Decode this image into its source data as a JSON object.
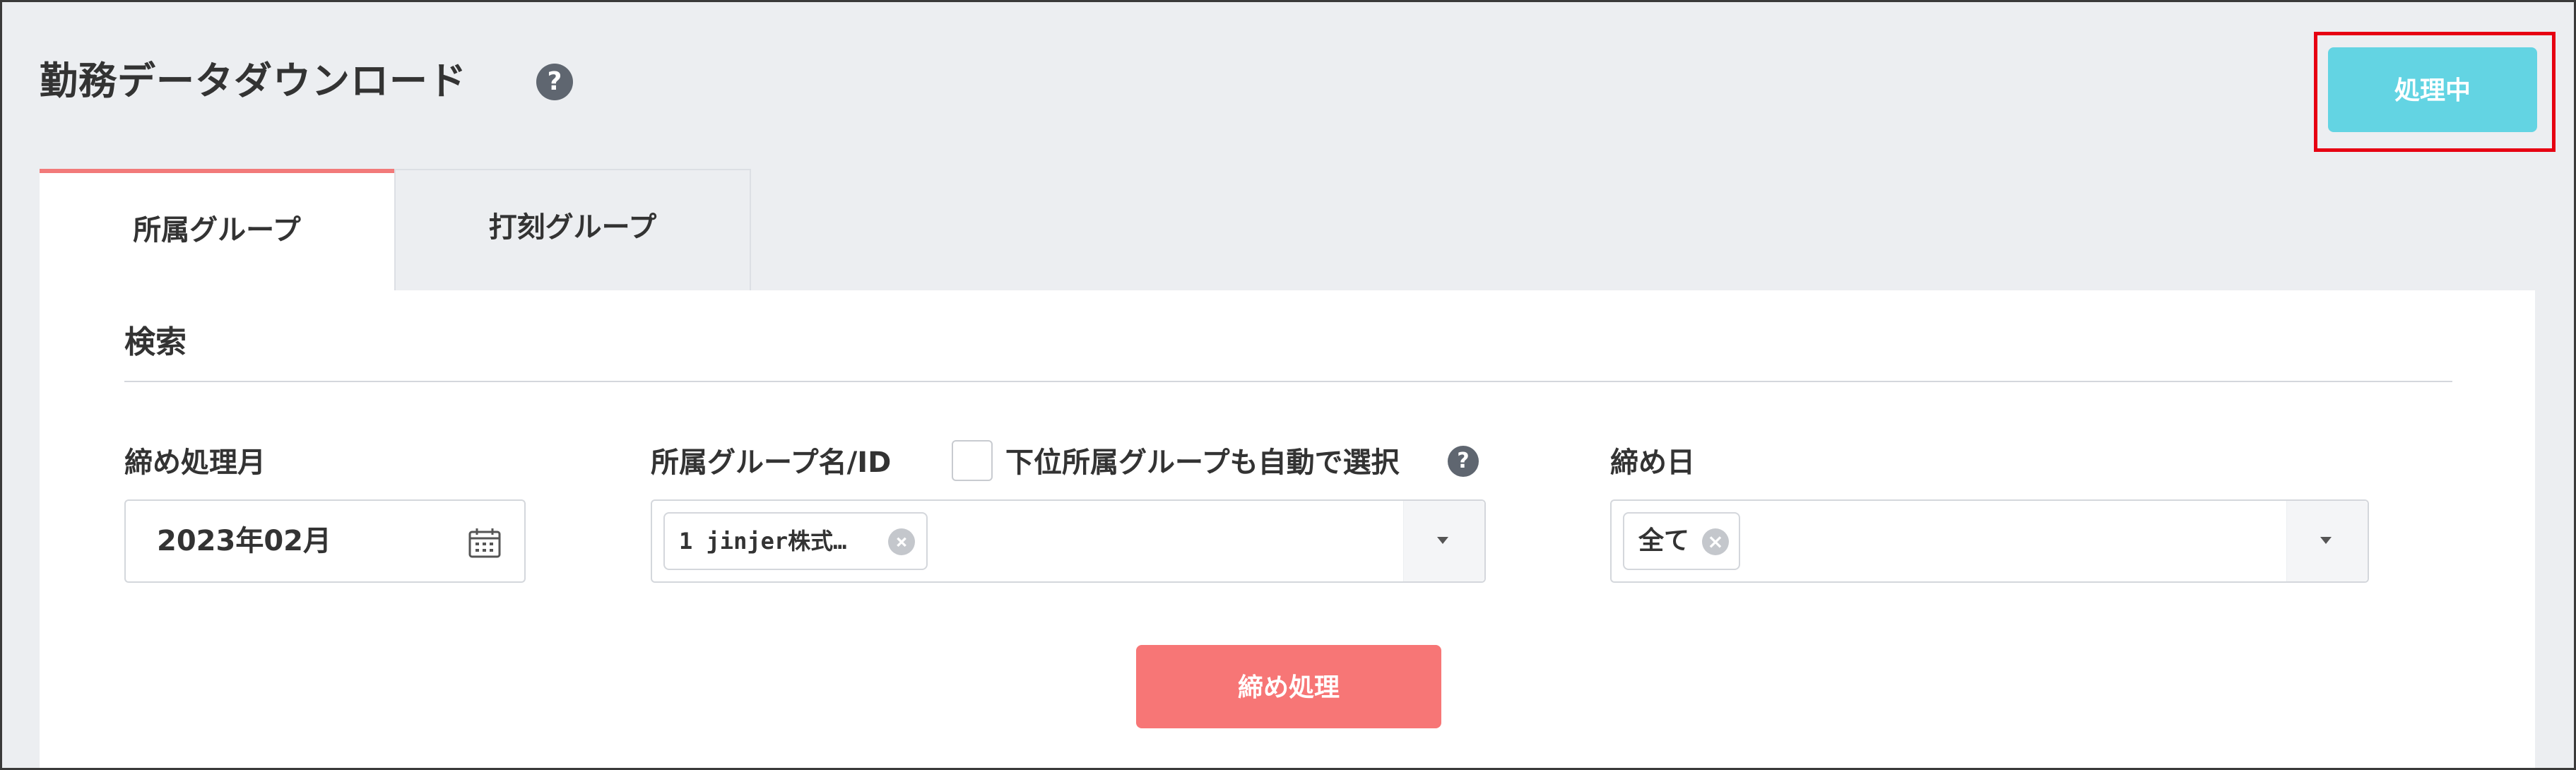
{
  "page": {
    "title": "勤務データダウンロード",
    "help_icon": "?",
    "processing_label": "処理中"
  },
  "tabs": [
    {
      "label": "所属グループ",
      "active": true
    },
    {
      "label": "打刻グループ",
      "active": false
    }
  ],
  "search": {
    "title": "検索",
    "closing_month": {
      "label": "締め処理月",
      "value": "2023年02月",
      "icon": "calendar-icon"
    },
    "group": {
      "label": "所属グループ名/ID",
      "auto_select_label": "下位所属グループも自動で選択",
      "auto_select_checked": false,
      "selected_tag": "1 jinjer株式…",
      "help_icon": "?"
    },
    "closing_day": {
      "label": "締め日",
      "selected_tag": "全て"
    },
    "remove_icon": "×",
    "close_process_label": "締め処理"
  },
  "colors": {
    "background": "#eceef1",
    "processing_button": "#63d4e3",
    "close_button": "#f77676",
    "active_tab_accent": "#f27a7a",
    "highlight": "#e60012"
  }
}
